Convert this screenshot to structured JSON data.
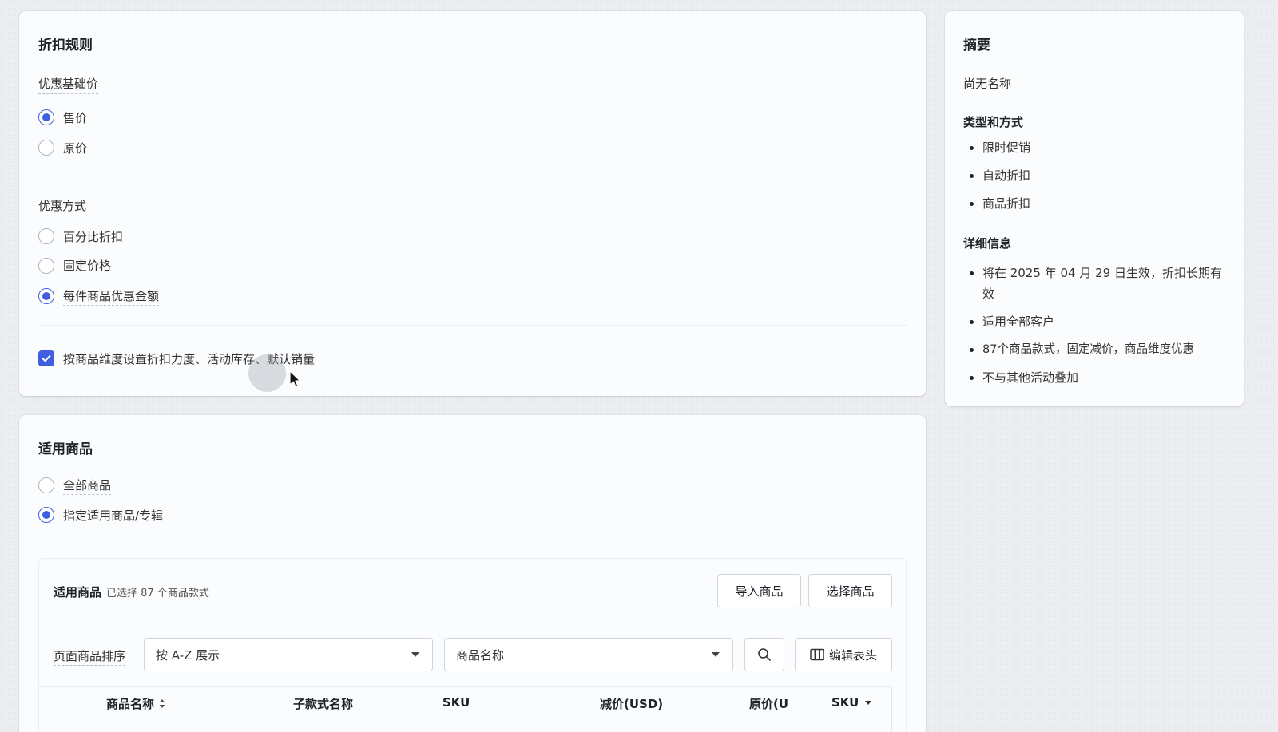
{
  "discount_rules": {
    "title": "折扣规则",
    "base_price": {
      "label": "优惠基础价",
      "options": [
        {
          "label": "售价",
          "checked": true
        },
        {
          "label": "原价",
          "checked": false
        }
      ]
    },
    "method": {
      "label": "优惠方式",
      "options": [
        {
          "label": "百分比折扣",
          "checked": false
        },
        {
          "label": "固定价格",
          "checked": false
        },
        {
          "label": "每件商品优惠金额",
          "checked": true
        }
      ]
    },
    "per_product_setting": {
      "label": "按商品维度设置折扣力度、活动库存、默认销量",
      "checked": true
    }
  },
  "applicable_products": {
    "title": "适用商品",
    "options": [
      {
        "label": "全部商品",
        "checked": false
      },
      {
        "label": "指定适用商品/专辑",
        "checked": true
      }
    ],
    "panel": {
      "title": "适用商品",
      "selected_text": "已选择 87 个商品款式",
      "import_button": "导入商品",
      "select_button": "选择商品",
      "sort_label": "页面商品排序",
      "sort_value": "按 A-Z 展示",
      "search_field_value": "商品名称",
      "edit_columns_button": "编辑表头",
      "columns": [
        "商品名称",
        "子款式名称",
        "SKU",
        "减价(USD)",
        "原价(U",
        "SKU"
      ]
    }
  },
  "summary": {
    "title": "摘要",
    "name": "尚无名称",
    "type_title": "类型和方式",
    "type_items": [
      "限时促销",
      "自动折扣",
      "商品折扣"
    ],
    "detail_title": "详细信息",
    "detail_items": [
      "将在 2025 年 04 月 29 日生效，折扣长期有效",
      "适用全部客户",
      "87个商品款式，固定减价，商品维度优惠",
      "不与其他活动叠加"
    ]
  },
  "colors": {
    "accent": "#3f5fe0",
    "card_background": "#fbfcfe",
    "page_background": "#eceef1"
  }
}
